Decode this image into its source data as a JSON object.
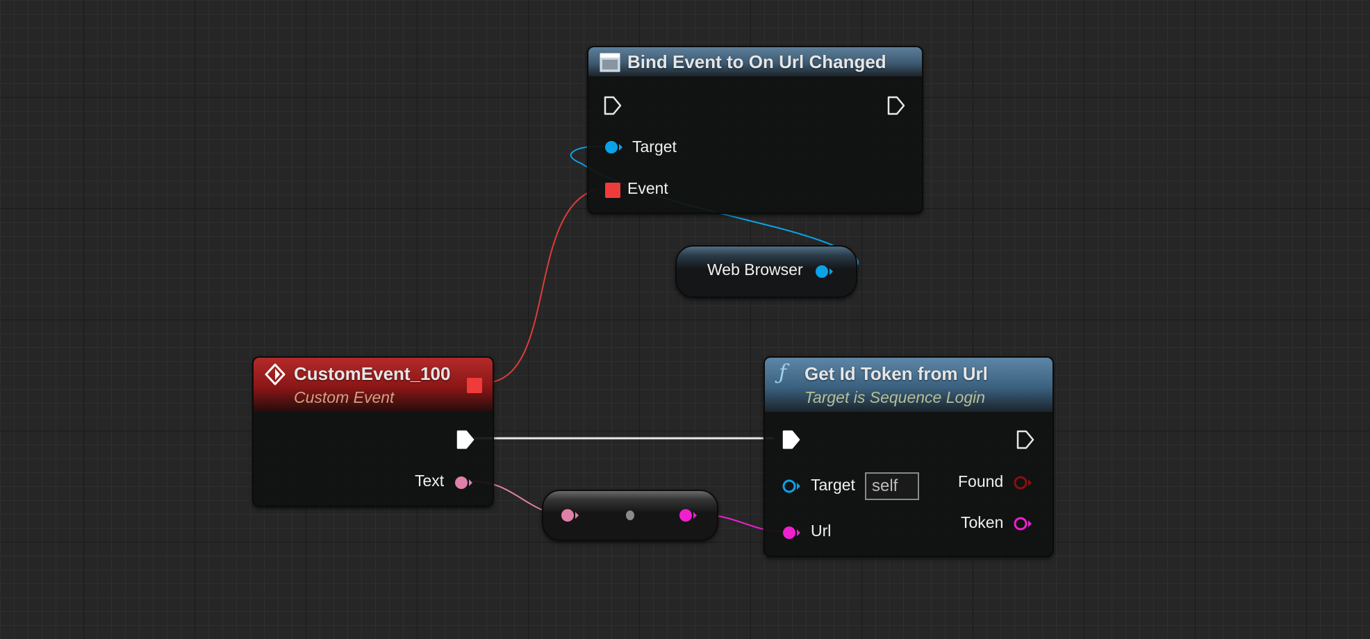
{
  "colors": {
    "background": "#262626",
    "exec_wire": "#e8e8e8",
    "object_pin": "#03a9f4",
    "delegate_pin": "#f03b3b",
    "text_pin": "#e07fa8",
    "string_pin": "#f020d0",
    "bool_pin": "#8a1010"
  },
  "nodes": {
    "bind_event": {
      "title": "Bind Event to On Url Changed",
      "icon": "widget-window-icon",
      "pins": {
        "exec_in": "exec-input-pin",
        "exec_out": "exec-output-pin",
        "target": "Target",
        "event": "Event"
      }
    },
    "web_browser": {
      "label": "Web Browser",
      "icon": "object-pin-icon"
    },
    "custom_event": {
      "title": "CustomEvent_100",
      "subtitle": "Custom Event",
      "icon": "event-diamond-icon",
      "pins": {
        "delegate_out": "delegate-pin",
        "exec_out": "exec-output-pin",
        "text": "Text"
      }
    },
    "reroute": {
      "icon": "conversion-dot-icon"
    },
    "get_token": {
      "title": "Get Id Token from Url",
      "subtitle": "Target is Sequence Login",
      "icon": "function-icon",
      "icon_glyph": "ƒ",
      "pins": {
        "target": "Target",
        "target_value": "self",
        "url": "Url",
        "found": "Found",
        "token": "Token"
      }
    }
  }
}
